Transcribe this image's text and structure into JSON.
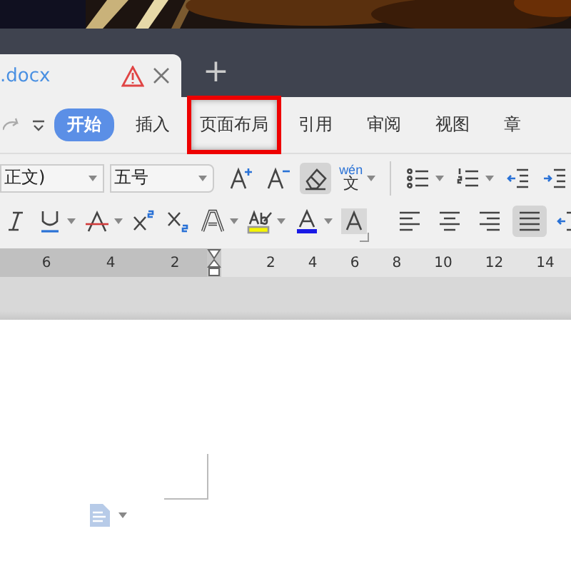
{
  "document_tabs": [
    {
      "label": ".docx",
      "warning": true,
      "selected": true
    }
  ],
  "new_tab": "+",
  "ribbon_tabs": [
    {
      "label": "开始",
      "selected": true,
      "highlighted": false
    },
    {
      "label": "插入",
      "selected": false,
      "highlighted": false
    },
    {
      "label": "页面布局",
      "selected": false,
      "highlighted": true
    },
    {
      "label": "引用",
      "selected": false,
      "highlighted": false
    },
    {
      "label": "审阅",
      "selected": false,
      "highlighted": false
    },
    {
      "label": "视图",
      "selected": false,
      "highlighted": false
    },
    {
      "label": "章",
      "selected": false,
      "highlighted": false
    }
  ],
  "font_field": {
    "value": "正文)"
  },
  "size_field": {
    "value": "五号"
  },
  "row1_tools": [
    {
      "kind": "font-grow",
      "selected": false,
      "caret": false
    },
    {
      "kind": "font-shrink",
      "selected": false,
      "caret": false
    },
    {
      "kind": "eraser",
      "selected": true,
      "caret": false
    },
    {
      "kind": "pinyin",
      "selected": false,
      "caret": true,
      "top": "wén",
      "bottom": "文"
    }
  ],
  "para_row1": [
    {
      "kind": "bullets",
      "selected": false,
      "caret": true
    },
    {
      "kind": "numbering",
      "selected": false,
      "caret": true
    },
    {
      "kind": "indent-decrease",
      "selected": false,
      "caret": false
    },
    {
      "kind": "indent-increase",
      "selected": false,
      "caret": false
    }
  ],
  "row2_tools": [
    {
      "kind": "italic",
      "selected": false,
      "caret": false
    },
    {
      "kind": "underline",
      "selected": false,
      "caret": true
    },
    {
      "kind": "strikethrough",
      "selected": false,
      "caret": true
    },
    {
      "kind": "superscript",
      "selected": false,
      "caret": false
    },
    {
      "kind": "subscript",
      "selected": false,
      "caret": false
    },
    {
      "kind": "text-effect",
      "selected": false,
      "caret": true
    },
    {
      "kind": "highlight",
      "selected": false,
      "caret": true
    },
    {
      "kind": "font-color",
      "selected": false,
      "caret": true
    },
    {
      "kind": "shading",
      "selected": false,
      "caret": false
    }
  ],
  "para_row2": [
    {
      "kind": "align-left",
      "selected": false
    },
    {
      "kind": "align-center",
      "selected": false
    },
    {
      "kind": "align-right",
      "selected": false
    },
    {
      "kind": "justify",
      "selected": true
    },
    {
      "kind": "distribute",
      "selected": false
    }
  ],
  "ruler": {
    "left_labels": [
      "6",
      "4",
      "2"
    ],
    "right_labels": [
      "2",
      "4",
      "6",
      "8",
      "10",
      "12",
      "14"
    ]
  }
}
